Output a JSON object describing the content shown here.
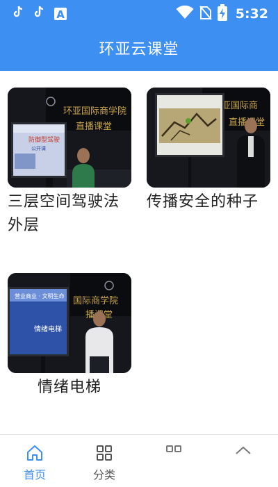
{
  "status_bar": {
    "icons": [
      "tiktok-icon",
      "tiktok-icon",
      "a-app-icon",
      "wifi-icon",
      "no-sim-icon",
      "battery-charging-icon"
    ],
    "a_glyph": "A",
    "time": "5:32"
  },
  "header": {
    "title": "环亚云课堂"
  },
  "videos": [
    {
      "title": "三层空间驾驶法外层",
      "backdrop_text": [
        "环亚国际商学院",
        "直播课堂"
      ],
      "screen_text": [
        "防御型驾驶",
        "公开课"
      ]
    },
    {
      "title": "传播安全的种子",
      "backdrop_text": [
        "亚国际商",
        "直播课堂"
      ],
      "screen_text": []
    },
    {
      "title": "情绪电梯",
      "backdrop_text": [
        "国际商学院",
        "播课堂"
      ],
      "screen_text": [
        "营业商业 · 文明生命",
        "情绪电梯"
      ]
    }
  ],
  "bottom_nav": {
    "items": [
      {
        "label": "首页",
        "icon": "home-icon",
        "active": true
      },
      {
        "label": "分类",
        "icon": "grid-icon",
        "active": false
      },
      {
        "label": "",
        "icon": "grid-icon",
        "active": false
      },
      {
        "label": "",
        "icon": "chevron-up-icon",
        "active": false
      }
    ]
  },
  "colors": {
    "primary": "#3d8ff2",
    "text": "#222222",
    "nav_inactive": "#555555"
  }
}
